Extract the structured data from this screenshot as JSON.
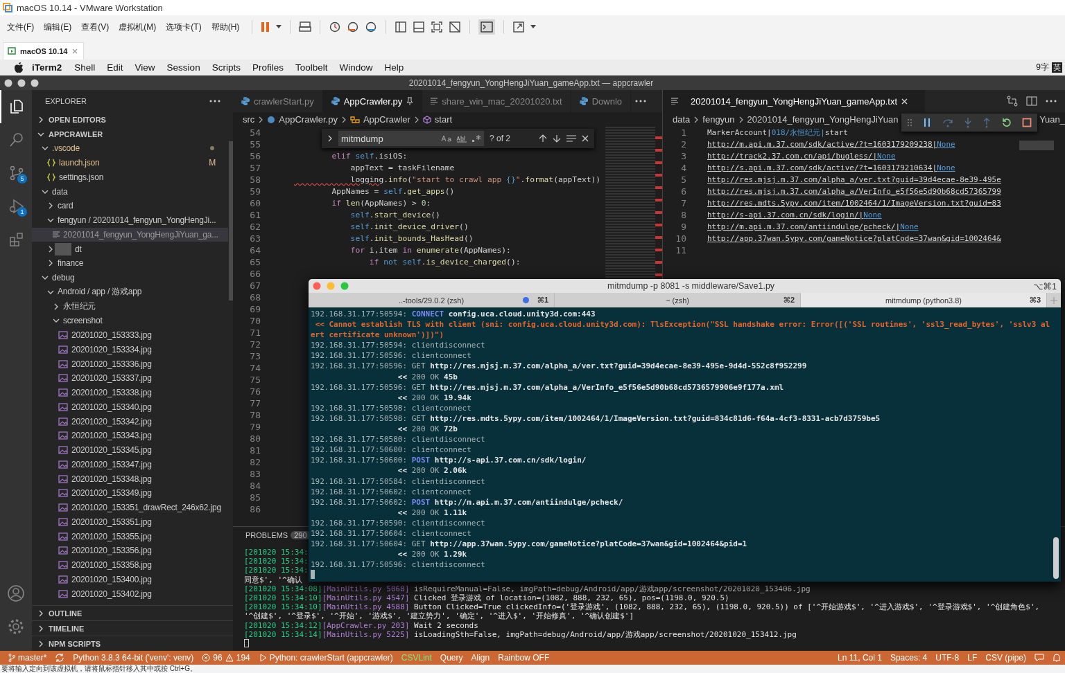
{
  "vmware": {
    "title": "macOS 10.14 - VMware Workstation",
    "menus": [
      "文件(F)",
      "编辑(E)",
      "查看(V)",
      "虚拟机(M)",
      "选项卡(T)",
      "帮助(H)"
    ],
    "tab": {
      "label": "macOS 10.14"
    },
    "status_text": "要将输入定向到该虚拟机，请将鼠标指针移入其中或按 Ctrl+G。"
  },
  "mac_menubar": {
    "app": "iTerm2",
    "menus": [
      "Shell",
      "Edit",
      "View",
      "Session",
      "Scripts",
      "Profiles",
      "Toolbelt",
      "Window",
      "Help"
    ],
    "input_count": "9字",
    "input_mode": "英"
  },
  "vscode": {
    "title": "20201014_fengyun_YongHengJiYuan_gameApp.txt — appcrawler",
    "activity_bar": [
      {
        "kind": "files",
        "selected": true
      },
      {
        "kind": "search",
        "selected": false
      },
      {
        "kind": "source-control",
        "badge": "5",
        "selected": false
      },
      {
        "kind": "run",
        "badge": "1",
        "selected": false
      },
      {
        "kind": "extensions",
        "selected": false
      }
    ],
    "sidebar": {
      "title": "EXPLORER",
      "sections": [
        {
          "title": "OPEN EDITORS",
          "expanded": false
        },
        {
          "title": "APPCRAWLER",
          "expanded": true,
          "tree": [
            {
              "label": ".vscode",
              "kind": "folder",
              "expanded": true,
              "modified": true,
              "selected": false,
              "children": [
                {
                  "label": "launch.json",
                  "kind": "json",
                  "modified": true,
                  "badge": "M",
                  "selected": false
                },
                {
                  "label": "settings.json",
                  "kind": "json",
                  "modified": false,
                  "selected": false
                }
              ]
            },
            {
              "label": "data",
              "kind": "folder",
              "expanded": true,
              "modified": false,
              "selected": false,
              "children": [
                {
                  "label": "card",
                  "kind": "folder",
                  "expanded": false,
                  "modified": false,
                  "selected": false
                },
                {
                  "label": "fengyun / 20201014_fengyun_YongHengJi...",
                  "kind": "folder",
                  "expanded": true,
                  "modified": false,
                  "selected": false,
                  "children": [
                    {
                      "label": "20201014_fengyun_YongHengJiYuan_ga...",
                      "kind": "txt",
                      "modified": false,
                      "selected": true
                    }
                  ]
                },
                {
                  "label": "dt",
                  "kind": "folder",
                  "expanded": false,
                  "modified": false,
                  "redacted": true,
                  "selected": false
                },
                {
                  "label": "finance",
                  "kind": "folder",
                  "expanded": false,
                  "modified": false,
                  "selected": false
                }
              ]
            },
            {
              "label": "debug",
              "kind": "folder",
              "expanded": true,
              "modified": false,
              "selected": false,
              "children": [
                {
                  "label": "Android / app / 游戏app",
                  "kind": "folder",
                  "expanded": true,
                  "modified": false,
                  "selected": false,
                  "children": [
                    {
                      "label": "永恒纪元",
                      "kind": "folder",
                      "expanded": false,
                      "modified": false,
                      "selected": false
                    },
                    {
                      "label": "screenshot",
                      "kind": "folder",
                      "expanded": true,
                      "modified": false,
                      "selected": false,
                      "children": [
                        {
                          "label": "20201020_153333.jpg",
                          "kind": "image",
                          "modified": false,
                          "selected": false
                        },
                        {
                          "label": "20201020_153334.jpg",
                          "kind": "image",
                          "modified": false,
                          "selected": false
                        },
                        {
                          "label": "20201020_153336.jpg",
                          "kind": "image",
                          "modified": false,
                          "selected": false
                        },
                        {
                          "label": "20201020_153337.jpg",
                          "kind": "image",
                          "modified": false,
                          "selected": false
                        },
                        {
                          "label": "20201020_153338.jpg",
                          "kind": "image",
                          "modified": false,
                          "selected": false
                        },
                        {
                          "label": "20201020_153340.jpg",
                          "kind": "image",
                          "modified": false,
                          "selected": false
                        },
                        {
                          "label": "20201020_153342.jpg",
                          "kind": "image",
                          "modified": false,
                          "selected": false
                        },
                        {
                          "label": "20201020_153343.jpg",
                          "kind": "image",
                          "modified": false,
                          "selected": false
                        },
                        {
                          "label": "20201020_153345.jpg",
                          "kind": "image",
                          "modified": false,
                          "selected": false
                        },
                        {
                          "label": "20201020_153347.jpg",
                          "kind": "image",
                          "modified": false,
                          "selected": false
                        },
                        {
                          "label": "20201020_153348.jpg",
                          "kind": "image",
                          "modified": false,
                          "selected": false
                        },
                        {
                          "label": "20201020_153349.jpg",
                          "kind": "image",
                          "modified": false,
                          "selected": false
                        },
                        {
                          "label": "20201020_153351_drawRect_246x62.jpg",
                          "kind": "image",
                          "modified": false,
                          "selected": false
                        },
                        {
                          "label": "20201020_153351.jpg",
                          "kind": "image",
                          "modified": false,
                          "selected": false
                        },
                        {
                          "label": "20201020_153355.jpg",
                          "kind": "image",
                          "modified": false,
                          "selected": false
                        },
                        {
                          "label": "20201020_153356.jpg",
                          "kind": "image",
                          "modified": false,
                          "selected": false
                        },
                        {
                          "label": "20201020_153358.jpg",
                          "kind": "image",
                          "modified": false,
                          "selected": false
                        },
                        {
                          "label": "20201020_153400.jpg",
                          "kind": "image",
                          "modified": false,
                          "selected": false
                        },
                        {
                          "label": "20201020_153402.jpg",
                          "kind": "image",
                          "modified": false,
                          "selected": false
                        }
                      ]
                    }
                  ]
                }
              ]
            }
          ]
        }
      ],
      "bottom_sections": [
        {
          "title": "OUTLINE",
          "expanded": false
        },
        {
          "title": "TIMELINE",
          "expanded": false
        },
        {
          "title": "NPM SCRIPTS",
          "expanded": false
        }
      ]
    },
    "editor_groups": [
      {
        "tabs": [
          {
            "label": "crawlerStart.py",
            "kind": "py",
            "selected": false,
            "pinned": false
          },
          {
            "label": "AppCrawler.py",
            "kind": "py",
            "selected": true,
            "pinned": true
          },
          {
            "label": "share_win_mac_20201020.txt",
            "kind": "txt",
            "selected": false,
            "pinned": false
          },
          {
            "label": "Downlo",
            "kind": "py",
            "selected": false,
            "pinned": false
          }
        ],
        "breadcrumb": [
          {
            "label": "src",
            "kind": "folder"
          },
          {
            "label": "AppCrawler.py",
            "kind": "py"
          },
          {
            "label": "AppCrawler",
            "kind": "class"
          },
          {
            "label": "start",
            "kind": "method"
          }
        ],
        "find": {
          "query": "mitmdump",
          "count": "? of 2"
        },
        "lines": [
          {
            "n": "54"
          },
          {
            "n": "55"
          },
          {
            "n": "56",
            "tokens": [
              {
                "text": "        elif ",
                "kind": "kw"
              },
              {
                "text": "self",
                "kind": "self"
              },
              {
                "text": ".isiOS:",
                "kind": "p"
              }
            ]
          },
          {
            "n": "57",
            "tokens": [
              {
                "text": "            appText = taskFilename",
                "kind": "p"
              }
            ]
          },
          {
            "n": "58",
            "tokens": [
              {
                "text": "            logging",
                "kind": "err"
              },
              {
                "text": ".",
                "kind": "p"
              },
              {
                "text": "info",
                "kind": "fn"
              },
              {
                "text": "(",
                "kind": "p"
              },
              {
                "text": "\"start to crawl app ",
                "kind": "str"
              },
              {
                "text": "{}",
                "kind": "self"
              },
              {
                "text": "\"",
                "kind": "str"
              },
              {
                "text": ".",
                "kind": "p"
              },
              {
                "text": "format",
                "kind": "fn"
              },
              {
                "text": "(appText))",
                "kind": "p"
              }
            ]
          },
          {
            "n": "59",
            "tokens": [
              {
                "text": "        AppNames = ",
                "kind": "p"
              },
              {
                "text": "self",
                "kind": "self"
              },
              {
                "text": ".",
                "kind": "p"
              },
              {
                "text": "get_apps",
                "kind": "fn"
              },
              {
                "text": "()",
                "kind": "p"
              }
            ]
          },
          {
            "n": "60",
            "tokens": [
              {
                "text": "        if ",
                "kind": "kw"
              },
              {
                "text": "len",
                "kind": "fn"
              },
              {
                "text": "(AppNames) > ",
                "kind": "p"
              },
              {
                "text": "0",
                "kind": "num"
              },
              {
                "text": ":",
                "kind": "p"
              }
            ]
          },
          {
            "n": "61",
            "tokens": [
              {
                "text": "            self",
                "kind": "self"
              },
              {
                "text": ".",
                "kind": "p"
              },
              {
                "text": "start_device",
                "kind": "fn"
              },
              {
                "text": "()",
                "kind": "p"
              }
            ]
          },
          {
            "n": "62",
            "tokens": [
              {
                "text": "            self",
                "kind": "self"
              },
              {
                "text": ".",
                "kind": "p"
              },
              {
                "text": "init_device_driver",
                "kind": "fn"
              },
              {
                "text": "()",
                "kind": "p"
              }
            ]
          },
          {
            "n": "63",
            "tokens": [
              {
                "text": "            self",
                "kind": "self"
              },
              {
                "text": ".",
                "kind": "p"
              },
              {
                "text": "init_bounds_HasHead",
                "kind": "fn"
              },
              {
                "text": "()",
                "kind": "p"
              }
            ]
          },
          {
            "n": "64",
            "tokens": [
              {
                "text": "            for",
                "kind": "kw"
              },
              {
                "text": " i,item ",
                "kind": "p"
              },
              {
                "text": "in",
                "kind": "kw"
              },
              {
                "text": " enumerate",
                "kind": "fn"
              },
              {
                "text": "(AppNames):",
                "kind": "p"
              }
            ]
          },
          {
            "n": "65",
            "tokens": [
              {
                "text": "                if",
                "kind": "kw"
              },
              {
                "text": " not self",
                "kind": "self"
              },
              {
                "text": ".",
                "kind": "p"
              },
              {
                "text": "is_device_charged",
                "kind": "fn"
              },
              {
                "text": "():",
                "kind": "p"
              }
            ]
          },
          {
            "n": "66"
          },
          {
            "n": "67"
          },
          {
            "n": "68"
          },
          {
            "n": "69"
          },
          {
            "n": "70"
          },
          {
            "n": "71"
          },
          {
            "n": "72"
          },
          {
            "n": "73"
          },
          {
            "n": "74"
          },
          {
            "n": "75"
          },
          {
            "n": "76"
          },
          {
            "n": "77"
          },
          {
            "n": "78"
          },
          {
            "n": "79"
          },
          {
            "n": "80"
          },
          {
            "n": "81"
          },
          {
            "n": "82"
          },
          {
            "n": "83"
          },
          {
            "n": "84"
          },
          {
            "n": "85"
          },
          {
            "n": "86"
          }
        ]
      },
      {
        "tabs": [
          {
            "label": "20201014_fengyun_YongHengJiYuan_gameApp.txt",
            "kind": "txt",
            "selected": true,
            "pinned": false
          }
        ],
        "breadcrumb": [
          {
            "label": "data"
          },
          {
            "label": "fengyun"
          },
          {
            "label": "20201014_fengyun_YongHengJiYuan"
          },
          {
            "label": "Yuan_"
          }
        ],
        "lines": [
          {
            "n": "1",
            "tokens": [
              {
                "text": "MarkerAccount|",
                "kind": "p"
              },
              {
                "text": "018/永恒纪元|",
                "kind": "col"
              },
              {
                "text": "start",
                "kind": "p"
              }
            ]
          },
          {
            "n": "2",
            "tokens": [
              {
                "text": "http://m.api.m.37.com/sdk/active/?t=1603179209238|",
                "kind": "link"
              },
              {
                "text": "None",
                "kind": "none"
              }
            ]
          },
          {
            "n": "3",
            "tokens": [
              {
                "text": "http://track2.37.com.cn/api/bugless/|",
                "kind": "link"
              },
              {
                "text": "None",
                "kind": "none"
              }
            ]
          },
          {
            "n": "4",
            "tokens": [
              {
                "text": "http://s.api.m.37.com/sdk/active/?t=1603179210634|",
                "kind": "link"
              },
              {
                "text": "None",
                "kind": "none"
              }
            ]
          },
          {
            "n": "5",
            "tokens": [
              {
                "text": "http://res.mjsj.m.37.com/alpha_a/ver.txt?guid=39d4ecae-8e39-495e",
                "kind": "link"
              }
            ]
          },
          {
            "n": "6",
            "tokens": [
              {
                "text": "http://res.mjsj.m.37.com/alpha_a/VerInfo_e5f56e5d90b68cd57365799",
                "kind": "link"
              }
            ]
          },
          {
            "n": "7",
            "tokens": [
              {
                "text": "http://res.mdts.5ypy.com/item/1002464/1/ImageVersion.txt?guid=83",
                "kind": "link"
              }
            ]
          },
          {
            "n": "8",
            "tokens": [
              {
                "text": "http://s-api.37.com.cn/sdk/login/|",
                "kind": "link"
              },
              {
                "text": "None",
                "kind": "none"
              }
            ]
          },
          {
            "n": "9",
            "tokens": [
              {
                "text": "http://m.api.m.37.com/antiindulge/pcheck/|",
                "kind": "link"
              },
              {
                "text": "None",
                "kind": "none"
              }
            ]
          },
          {
            "n": "10",
            "tokens": [
              {
                "text": "http://app.37wan.5ypy.com/gameNotice?platCode=37wan&gid=1002464&",
                "kind": "link"
              }
            ]
          },
          {
            "n": "11"
          }
        ]
      }
    ],
    "panel": {
      "tab": "PROBLEMS",
      "count": "290",
      "lines": [
        [
          {
            "text": "[201020 15:34:",
            "kind": "ts"
          }
        ],
        [
          {
            "text": "[201020 15:34:",
            "kind": "ts"
          }
        ],
        [
          {
            "text": "[201020 15:34:",
            "kind": "ts"
          }
        ],
        [
          {
            "text": "同意$', '^确认",
            "kind": "msg"
          }
        ],
        [
          {
            "text": "[201020 15:34:08]",
            "kind": "ts"
          },
          {
            "text": "[MainUtils.py 5068]",
            "kind": "src"
          },
          {
            "text": " isRequireManual=False, imgPath=debug/Android/app/游戏app/screenshot/20201020_153406.jpg",
            "kind": "msg"
          }
        ],
        [
          {
            "text": "[201020 15:34:10]",
            "kind": "ts"
          },
          {
            "text": "[MainUtils.py 4547]",
            "kind": "src"
          },
          {
            "text": " Clicked 登录游戏 of location=(1082, 888, 232, 65), pos=(1198.0, 920.5)",
            "kind": "msg"
          }
        ],
        [
          {
            "text": "[201020 15:34:10]",
            "kind": "ts"
          },
          {
            "text": "[MainUtils.py 4588]",
            "kind": "src"
          },
          {
            "text": " Button Clicked=True clickedInfo=('登录游戏', (1082, 888, 232, 65), (1198.0, 920.5)) of ['^开始游戏$', '^进入游戏$', '^登录游戏$', '^创建角色$', '^创建$', '^登录$', '^开始', '游戏$', '建立势力', '确定', '^进入$', '开始修真', '^确认创建$']",
            "kind": "msg"
          }
        ],
        [
          {
            "text": "[201020 15:34:12]",
            "kind": "ts"
          },
          {
            "text": "[AppCrawler.py 203]",
            "kind": "src"
          },
          {
            "text": " Wait 2 seconds",
            "kind": "msg"
          }
        ],
        [
          {
            "text": "[201020 15:34:14]",
            "kind": "ts"
          },
          {
            "text": "[MainUtils.py 5225]",
            "kind": "src"
          },
          {
            "text": " isLoadingSth=False, imgPath=debug/Android/app/游戏app/screenshot/20201020_153412.jpg",
            "kind": "msg"
          }
        ]
      ]
    },
    "status_bar": {
      "left": [
        {
          "kind": "branch",
          "text": "master*"
        },
        {
          "kind": "sync"
        },
        {
          "kind": "text",
          "text": "Python 3.8.3 64-bit ('venv': venv)"
        },
        {
          "kind": "problems",
          "errors": "96",
          "warnings": "194"
        },
        {
          "kind": "debug",
          "text": "Python: crawlerStart (appcrawler)"
        },
        {
          "kind": "highlight",
          "text": "CSVLint"
        },
        {
          "kind": "text",
          "text": "Query"
        },
        {
          "kind": "text",
          "text": "Align"
        },
        {
          "kind": "text",
          "text": "Rainbow OFF"
        }
      ],
      "right": [
        {
          "kind": "text",
          "text": "Ln 11, Col 1"
        },
        {
          "kind": "text",
          "text": "Spaces: 4"
        },
        {
          "kind": "text",
          "text": "UTF-8"
        },
        {
          "kind": "text",
          "text": "LF"
        },
        {
          "kind": "text",
          "text": "CSV (pipe)"
        },
        {
          "kind": "feedback"
        },
        {
          "kind": "bell"
        }
      ]
    }
  },
  "iterm": {
    "title": "mitmdump -p 8081 -s middleware/Save1.py",
    "shortcut": "⌥⌘1",
    "tabs": [
      {
        "label": "..-tools/29.0.2 (zsh)",
        "shortcut": "⌘1",
        "activity": true,
        "selected": false
      },
      {
        "label": "~ (zsh)",
        "shortcut": "⌘2",
        "activity": false,
        "selected": false
      },
      {
        "label": "mitmdump (python3.8)",
        "shortcut": "⌘3",
        "activity": false,
        "selected": true
      }
    ],
    "lines": [
      [
        {
          "text": "192.168.31.177:50594: ",
          "kind": "addr"
        },
        {
          "text": "CONNECT",
          "kind": "method"
        },
        {
          "text": " config.uca.cloud.unity3d.com:443",
          "kind": "url"
        }
      ],
      [
        {
          "text": " << Cannot establish TLS with client (sni: config.uca.cloud.unity3d.com): TlsException(\"SSL handshake error: Error([('SSL routines', 'ssl3_read_bytes', 'sslv3 alert certificate unknown')])\")",
          "kind": "err"
        }
      ],
      [
        {
          "text": "192.168.31.177:50594: clientdisconnect",
          "kind": "addr"
        }
      ],
      [
        {
          "text": "192.168.31.177:50596: clientconnect",
          "kind": "addr"
        }
      ],
      [
        {
          "text": "192.168.31.177:50596: GET",
          "kind": "addr"
        },
        {
          "text": " http://res.mjsj.m.37.com/alpha_a/ver.txt?guid=39d4ecae-8e39-495e-9d4d-552c8f952299",
          "kind": "url"
        }
      ],
      [
        {
          "text": "                   <<",
          "kind": "url"
        },
        {
          "text": " 200 OK",
          "kind": "addr"
        },
        {
          "text": " 45b",
          "kind": "url"
        }
      ],
      [
        {
          "text": "192.168.31.177:50596: GET",
          "kind": "addr"
        },
        {
          "text": " http://res.mjsj.m.37.com/alpha_a/VerInfo_e5f56e5d90b68cd5736579906e9f177a.xml",
          "kind": "url"
        }
      ],
      [
        {
          "text": "                   <<",
          "kind": "url"
        },
        {
          "text": " 200 OK",
          "kind": "addr"
        },
        {
          "text": " 19.94k",
          "kind": "url"
        }
      ],
      [
        {
          "text": "192.168.31.177:50598: clientconnect",
          "kind": "addr"
        }
      ],
      [
        {
          "text": "192.168.31.177:50598: GET",
          "kind": "addr"
        },
        {
          "text": " http://res.mdts.5ypy.com/item/1002464/1/ImageVersion.txt?guid=834c81d6-f64a-4cf3-8331-acb7d3759be5",
          "kind": "url"
        }
      ],
      [
        {
          "text": "                   <<",
          "kind": "url"
        },
        {
          "text": " 200 OK",
          "kind": "addr"
        },
        {
          "text": " 72b",
          "kind": "url"
        }
      ],
      [
        {
          "text": "192.168.31.177:50580: clientdisconnect",
          "kind": "addr"
        }
      ],
      [
        {
          "text": "192.168.31.177:50600: clientconnect",
          "kind": "addr"
        }
      ],
      [
        {
          "text": "192.168.31.177:50600: ",
          "kind": "addr"
        },
        {
          "text": "POST",
          "kind": "method"
        },
        {
          "text": " http://s-api.37.com.cn/sdk/login/",
          "kind": "url"
        }
      ],
      [
        {
          "text": "                   <<",
          "kind": "url"
        },
        {
          "text": " 200 OK",
          "kind": "addr"
        },
        {
          "text": " 2.06k",
          "kind": "url"
        }
      ],
      [
        {
          "text": "192.168.31.177:50584: clientdisconnect",
          "kind": "addr"
        }
      ],
      [
        {
          "text": "192.168.31.177:50602: clientconnect",
          "kind": "addr"
        }
      ],
      [
        {
          "text": "192.168.31.177:50602: ",
          "kind": "addr"
        },
        {
          "text": "POST",
          "kind": "method"
        },
        {
          "text": " http://m.api.m.37.com/antiindulge/pcheck/",
          "kind": "url"
        }
      ],
      [
        {
          "text": "                   <<",
          "kind": "url"
        },
        {
          "text": " 200 OK",
          "kind": "addr"
        },
        {
          "text": " 1.11k",
          "kind": "url"
        }
      ],
      [
        {
          "text": "192.168.31.177:50590: clientdisconnect",
          "kind": "addr"
        }
      ],
      [
        {
          "text": "192.168.31.177:50604: clientconnect",
          "kind": "addr"
        }
      ],
      [
        {
          "text": "192.168.31.177:50604: GET",
          "kind": "addr"
        },
        {
          "text": " http://app.37wan.5ypy.com/gameNotice?platCode=37wan&gid=1002464&pid=1",
          "kind": "url"
        }
      ],
      [
        {
          "text": "                   <<",
          "kind": "url"
        },
        {
          "text": " 200 OK",
          "kind": "addr"
        },
        {
          "text": " 1.29k",
          "kind": "url"
        }
      ],
      [
        {
          "text": "192.168.31.177:50596: clientdisconnect",
          "kind": "addr"
        }
      ]
    ]
  }
}
